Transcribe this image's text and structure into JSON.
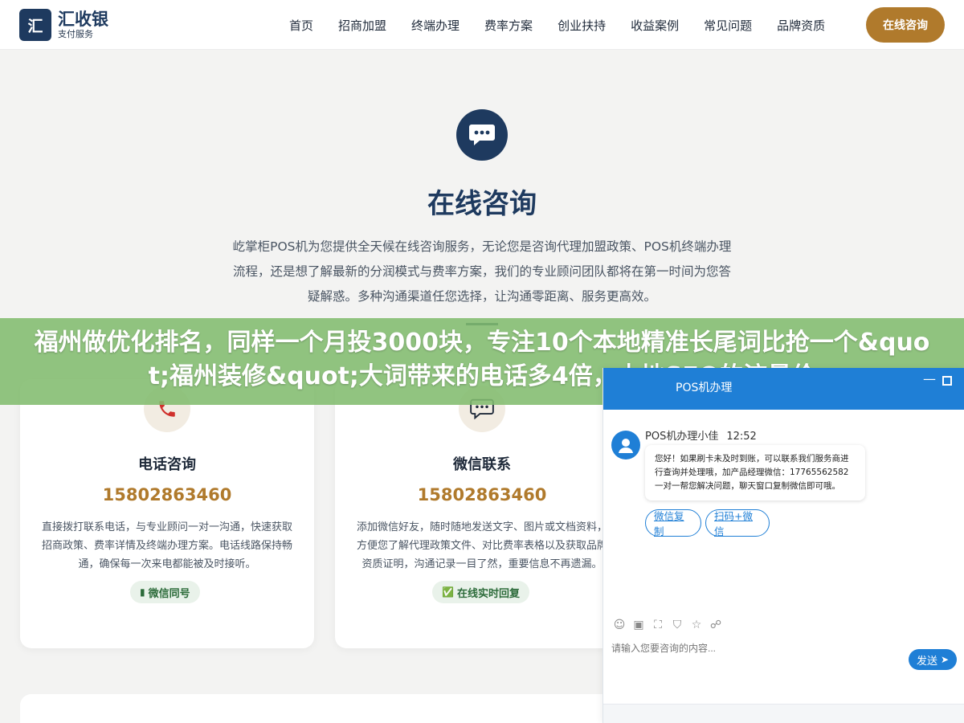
{
  "header": {
    "logo_mark": "汇",
    "logo_name": "汇收银",
    "logo_sub": "支付服务",
    "nav": [
      "首页",
      "招商加盟",
      "终端办理",
      "费率方案",
      "创业扶持",
      "收益案例",
      "常见问题",
      "品牌资质"
    ],
    "cta": "在线咨询"
  },
  "hero": {
    "title": "在线咨询",
    "description": "屹掌柜POS机为您提供全天候在线咨询服务，无论您是咨询代理加盟政策、POS机终端办理流程，还是想了解最新的分润模式与费率方案，我们的专业顾问团队都将在第一时间为您答疑解惑。多种沟通渠道任您选择，让沟通零距离、服务更高效。"
  },
  "banner": {
    "text": "福州做优化排名，同样一个月投3000块，专注10个本地精准长尾词比抢一个&quot;福州装修&quot;大词带来的电话多4倍，本地SEO的流量价"
  },
  "cards": [
    {
      "title": "电话咨询",
      "phone": "15802863460",
      "description": "直接拨打联系电话，与专业顾问一对一沟通，快速获取招商政策、费率详情及终端办理方案。电话线路保持畅通，确保每一次来电都能被及时接听。",
      "badge": "微信同号",
      "icon": "phone-icon"
    },
    {
      "title": "微信联系",
      "phone": "15802863460",
      "description": "添加微信好友，随时随地发送文字、图片或文档资料，方便您了解代理政策文件、对比费率表格以及获取品牌资质证明，沟通记录一目了然，重要信息不再遗漏。",
      "badge": "在线实时回复",
      "icon": "wechat-icon"
    }
  ],
  "chat": {
    "header_title": "POS机办理",
    "agent_name": "POS机办理小佳",
    "time": "12:52",
    "message": "您好！如果刷卡未及时到账，可以联系我们服务商进行查询并处理哦，加产品经理微信：17765562582 一对一帮您解决问题，聊天窗口复制微信即可哦。",
    "quick_buttons": [
      "微信复制",
      "扫码+微信"
    ],
    "input_placeholder": "请输入您要咨询的内容...",
    "send": "发送"
  },
  "colors": {
    "primary": "#1e3a5f",
    "accent": "#b07a2c",
    "chat_blue": "#1f7fd6",
    "banner_green": "#82bc6e"
  }
}
